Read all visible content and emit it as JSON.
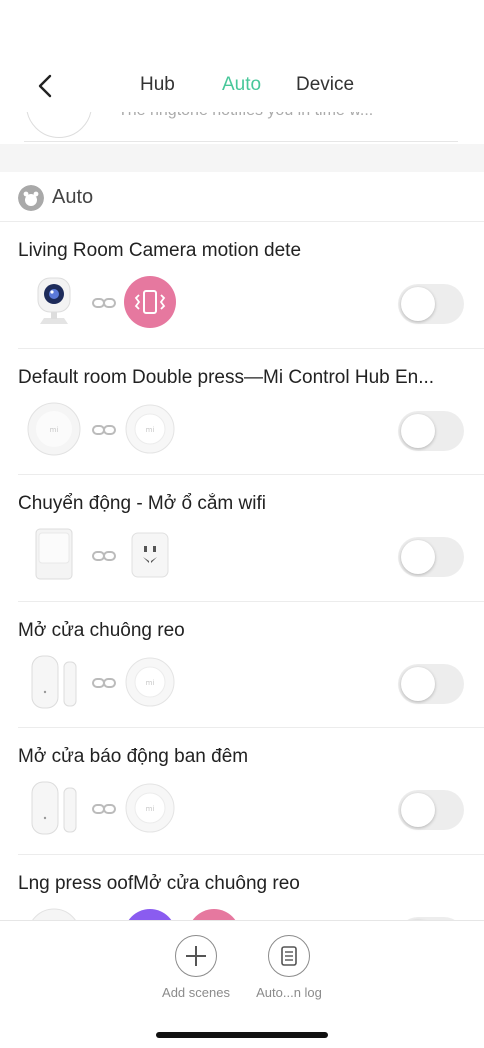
{
  "nav": {
    "tabs": [
      {
        "label": "Hub",
        "active": false
      },
      {
        "label": "Auto",
        "active": true
      },
      {
        "label": "Device",
        "active": false
      }
    ],
    "accent_color": "#48c79a"
  },
  "peek": {
    "text": "The ringtone notifies you in time w..."
  },
  "section": {
    "title": "Auto"
  },
  "automations": [
    {
      "title": "Living Room Camera motion dete",
      "trigger_icon": "camera-icon",
      "action_icon": "vibrate-icon",
      "enabled": false
    },
    {
      "title": "Default room Double press—Mi Control Hub En...",
      "trigger_icon": "wireless-switch-icon",
      "action_icon": "mi-hub-icon",
      "enabled": false
    },
    {
      "title": "Chuyển động - Mở ổ cắm wifi",
      "trigger_icon": "motion-sensor-icon",
      "action_icon": "wifi-plug-icon",
      "enabled": false
    },
    {
      "title": "Mở cửa chuông reo",
      "trigger_icon": "door-sensor-icon",
      "action_icon": "mi-hub-icon",
      "enabled": false
    },
    {
      "title": "Mở cửa báo động ban đêm",
      "trigger_icon": "door-sensor-icon",
      "action_icon": "mi-hub-icon",
      "enabled": false
    },
    {
      "title": "Lng press oofMở cửa chuông reo",
      "trigger_icon": "wireless-switch-icon",
      "action_icon": "purple-icon",
      "enabled": false
    }
  ],
  "bottom": {
    "add_label": "Add scenes",
    "log_label": "Auto...n log"
  }
}
